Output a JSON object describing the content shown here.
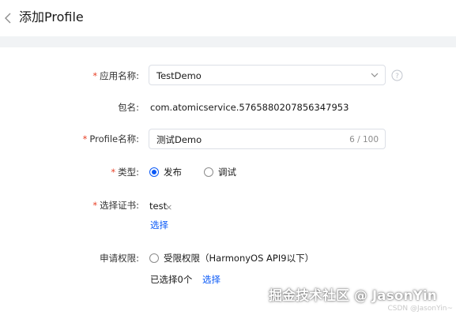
{
  "header": {
    "title": "添加Profile"
  },
  "form": {
    "app_name": {
      "required_mark": "*",
      "label": "应用名称:",
      "value": "TestDemo"
    },
    "package": {
      "label": "包名:",
      "value": "com.atomicservice.5765880207856347953"
    },
    "profile_name": {
      "required_mark": "*",
      "label": "Profile名称:",
      "value": "测试Demo",
      "counter": "6 / 100"
    },
    "type": {
      "required_mark": "*",
      "label": "类型:",
      "options": [
        {
          "label": "发布",
          "checked": true
        },
        {
          "label": "调试",
          "checked": false
        }
      ]
    },
    "certificate": {
      "required_mark": "*",
      "label": "选择证书:",
      "value": "test",
      "remove": "×",
      "select_link": "选择"
    },
    "permissions": {
      "label": "申请权限:",
      "option": "受限权限（HarmonyOS API9以下）",
      "selected_text": "已选择0个",
      "select_link": "选择"
    }
  },
  "watermark": {
    "main": "掘金技术社区 @ JasonYin",
    "small": "CSDN @JasonYin~"
  },
  "colors": {
    "accent": "#0a59f7",
    "required": "#e84026",
    "background": "#f1f3f5"
  }
}
